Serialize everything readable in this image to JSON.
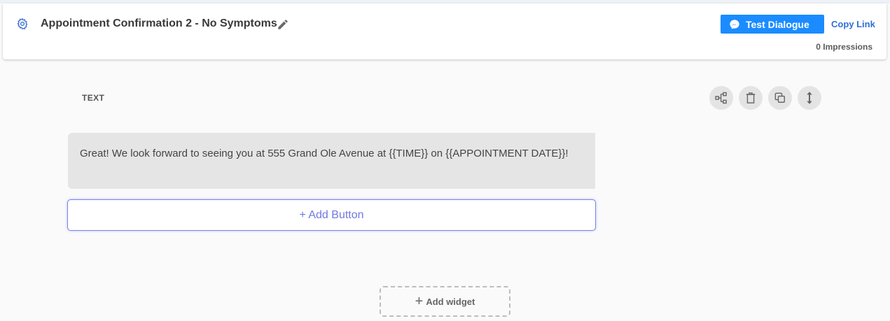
{
  "header": {
    "title": "Appointment Confirmation 2 - No Symptoms",
    "test_dialogue_label": "Test Dialogue",
    "copy_link_label": "Copy Link",
    "impressions": "0 Impressions"
  },
  "widget": {
    "type_label": "TEXT",
    "message": "Great! We look forward to seeing you at 555 Grand Ole Avenue at {{TIME}} on {{APPOINTMENT DATE}}!",
    "add_button_label": "+ Add Button",
    "tools": [
      "flow-icon",
      "trash-icon",
      "duplicate-icon",
      "resize-vertical-icon"
    ]
  },
  "footer": {
    "add_widget_label": "Add widget"
  },
  "colors": {
    "primary_button": "#1a8cff",
    "link": "#2f6fd6",
    "add_button_border": "#7b84f2",
    "bubble_bg": "#e5e5e5",
    "page_bg": "#fafafa"
  }
}
